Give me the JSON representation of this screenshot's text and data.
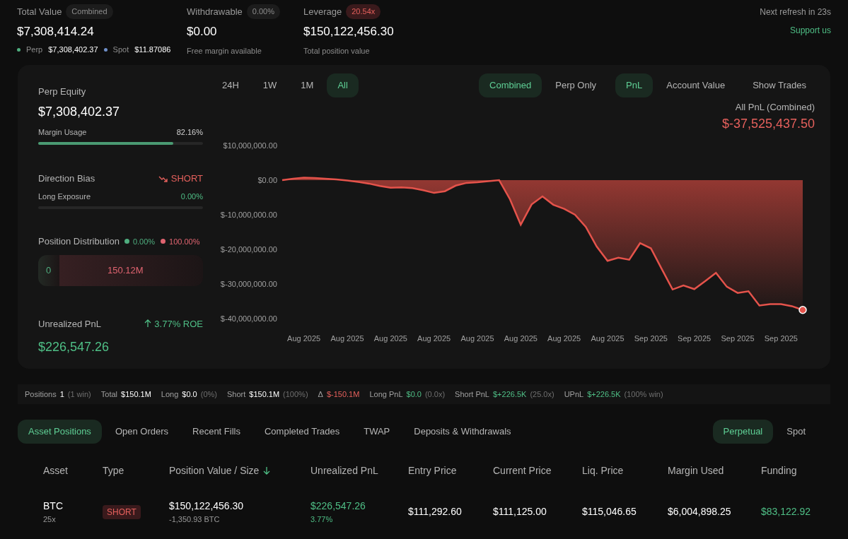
{
  "summary": [
    {
      "kind": "breakdown",
      "label": "Total Value",
      "badge": "Combined",
      "badge_alert": false,
      "value": "$7,308,414.24",
      "breakdown": [
        {
          "label": "Perp",
          "value": "$7,308,402.37",
          "color": "#4fae7f"
        },
        {
          "label": "Spot",
          "value": "$11.87086",
          "color": "#6f8fc9"
        }
      ]
    },
    {
      "kind": "note",
      "label": "Withdrawable",
      "badge": "0.00%",
      "badge_alert": false,
      "value": "$0.00",
      "note": "Free margin available"
    },
    {
      "kind": "note",
      "label": "Leverage",
      "badge": "20.54x",
      "badge_alert": true,
      "value": "$150,122,456.30",
      "note": "Total position value"
    }
  ],
  "refresh": "Next refresh in 23s",
  "support_link": "Support us",
  "equity": {
    "label": "Perp Equity",
    "value": "$7,308,402.37"
  },
  "margin_usage": {
    "label": "Margin Usage",
    "reading": "82.16%",
    "level": 0.8216
  },
  "direction_bias": {
    "label": "Direction Bias",
    "value": "SHORT"
  },
  "long_exposure": {
    "label": "Long Exposure",
    "reading": "0.00%",
    "level": 0
  },
  "position_distribution": {
    "label": "Position Distribution",
    "sides": [
      {
        "pct": "0.00%",
        "value": "0",
        "color": "#4fae7f"
      },
      {
        "pct": "100.00%",
        "value": "150.12M",
        "color": "#e06470"
      }
    ]
  },
  "unrealized_pnl": {
    "label": "Unrealized PnL",
    "roe": "3.77% ROE",
    "value": "$226,547.26"
  },
  "range_tabs": [
    {
      "label": "24H",
      "selected": false
    },
    {
      "label": "1W",
      "selected": false
    },
    {
      "label": "1M",
      "selected": false
    },
    {
      "label": "All",
      "selected": true
    }
  ],
  "scope_tabs": [
    {
      "label": "Combined",
      "selected": true
    },
    {
      "label": "Perp Only",
      "selected": false
    }
  ],
  "metric_tabs": [
    {
      "label": "PnL",
      "selected": true
    },
    {
      "label": "Account Value",
      "selected": false
    }
  ],
  "show_trades": "Show Trades",
  "chart": {
    "title": "All PnL (Combined)",
    "total": "$-37,525,437.50",
    "chart_data": {
      "type": "area",
      "ylim": [
        -40000000,
        10000000
      ],
      "yticks": [
        {
          "value": 10000000,
          "label": "$10,000,000.00"
        },
        {
          "value": 0,
          "label": "$0.00"
        },
        {
          "value": -10000000,
          "label": "$-10,000,000.00"
        },
        {
          "value": -20000000,
          "label": "$-20,000,000.00"
        },
        {
          "value": -30000000,
          "label": "$-30,000,000.00"
        },
        {
          "value": -40000000,
          "label": "$-40,000,000.00"
        }
      ],
      "categories": [
        null,
        null,
        "Aug 2025",
        null,
        null,
        null,
        "Aug 2025",
        null,
        null,
        null,
        "Aug 2025",
        null,
        null,
        null,
        "Aug 2025",
        null,
        null,
        null,
        "Aug 2025",
        null,
        null,
        null,
        "Aug 2025",
        null,
        null,
        null,
        "Aug 2025",
        null,
        null,
        null,
        "Aug 2025",
        null,
        null,
        null,
        "Sep 2025",
        null,
        null,
        null,
        "Sep 2025",
        null,
        null,
        null,
        "Sep 2025",
        null,
        null,
        null,
        "Sep 2025",
        null,
        null
      ],
      "series": [
        {
          "color": "#e5534b",
          "values": [
            0,
            400000,
            700000,
            600000,
            400000,
            200000,
            -100000,
            -500000,
            -1000000,
            -1700000,
            -2200000,
            -2100000,
            -2300000,
            -2900000,
            -3700000,
            -3200000,
            -1600000,
            -800000,
            -600000,
            -300000,
            0,
            -5500000,
            -12900000,
            -7000000,
            -4700000,
            -7100000,
            -8300000,
            -10000000,
            -13500000,
            -19200000,
            -23300000,
            -22400000,
            -23000000,
            -18200000,
            -19700000,
            -25700000,
            -31600000,
            -30400000,
            -31500000,
            -29200000,
            -26800000,
            -30800000,
            -32600000,
            -32100000,
            -36200000,
            -35800000,
            -35800000,
            -36400000,
            -37500000
          ]
        }
      ]
    }
  },
  "stats": [
    {
      "kind": "plain",
      "label": "Positions",
      "value": "1",
      "note": "(1 win)"
    },
    {
      "kind": "plain",
      "label": "Total",
      "value": "$150.1M"
    },
    {
      "kind": "plain",
      "label": "Long",
      "value": "$0.0",
      "note": "(0%)"
    },
    {
      "kind": "plain",
      "label": "Short",
      "value": "$150.1M",
      "note": "(100%)"
    },
    {
      "kind": "loss",
      "label": "Δ",
      "value": "$-150.1M"
    },
    {
      "kind": "gain",
      "label": "Long PnL",
      "value": "$0.0",
      "note": "(0.0x)"
    },
    {
      "kind": "gain",
      "label": "Short PnL",
      "value": "$+226.5K",
      "note": "(25.0x)"
    },
    {
      "kind": "gain",
      "label": "UPnL",
      "value": "$+226.5K",
      "note": "(100% win)"
    }
  ],
  "bottom_tabs": [
    {
      "label": "Asset Positions",
      "selected": true
    },
    {
      "label": "Open Orders",
      "selected": false
    },
    {
      "label": "Recent Fills",
      "selected": false
    },
    {
      "label": "Completed Trades",
      "selected": false
    },
    {
      "label": "TWAP",
      "selected": false
    },
    {
      "label": "Deposits & Withdrawals",
      "selected": false
    }
  ],
  "market_tabs": [
    {
      "label": "Perpetual",
      "selected": true
    },
    {
      "label": "Spot",
      "selected": false
    }
  ],
  "table": {
    "columns": [
      {
        "label": "Asset",
        "sorted": false
      },
      {
        "label": "Type",
        "sorted": false
      },
      {
        "label": "Position Value / Size",
        "sorted": true
      },
      {
        "label": "Unrealized PnL",
        "sorted": false
      },
      {
        "label": "Entry Price",
        "sorted": false
      },
      {
        "label": "Current Price",
        "sorted": false
      },
      {
        "label": "Liq. Price",
        "sorted": false
      },
      {
        "label": "Margin Used",
        "sorted": false
      },
      {
        "label": "Funding",
        "sorted": false
      }
    ],
    "rows": [
      {
        "asset": "BTC",
        "leverage": "25x",
        "type": "SHORT",
        "position_value": "$150,122,456.30",
        "size": "-1,350.93 BTC",
        "upnl": "$226,547.26",
        "upnl_pct": "3.77%",
        "entry_price": "$111,292.60",
        "current_price": "$111,125.00",
        "liq_price": "$115,046.65",
        "margin_used": "$6,004,898.25",
        "funding": "$83,122.92"
      }
    ]
  }
}
